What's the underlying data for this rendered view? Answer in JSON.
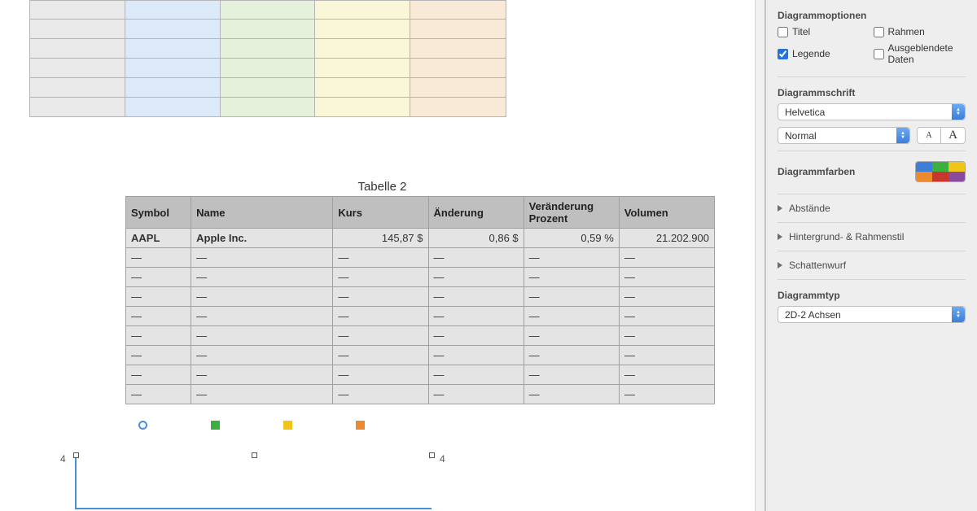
{
  "table_title": "Tabelle 2",
  "headers": {
    "symbol": "Symbol",
    "name": "Name",
    "kurs": "Kurs",
    "change": "Änderung",
    "change_pct": "Veränderung Prozent",
    "volume": "Volumen"
  },
  "row1": {
    "symbol": "AAPL",
    "name": "Apple Inc.",
    "kurs": "145,87 $",
    "change": "0,86 $",
    "change_pct": "0,59 %",
    "volume": "21.202.900"
  },
  "dash": "—",
  "chart_axis_left": "4",
  "chart_axis_right": "4",
  "sidebar": {
    "options_title": "Diagrammoptionen",
    "titel": "Titel",
    "rahmen": "Rahmen",
    "legende": "Legende",
    "hidden_data": "Ausgeblendete Daten",
    "font_title": "Diagrammschrift",
    "font_family": "Helvetica",
    "font_style": "Normal",
    "colors_title": "Diagrammfarben",
    "disclosure1": "Abstände",
    "disclosure2": "Hintergrund- & Rahmenstil",
    "disclosure3": "Schattenwurf",
    "type_title": "Diagrammtyp",
    "type_value": "2D-2 Achsen"
  }
}
